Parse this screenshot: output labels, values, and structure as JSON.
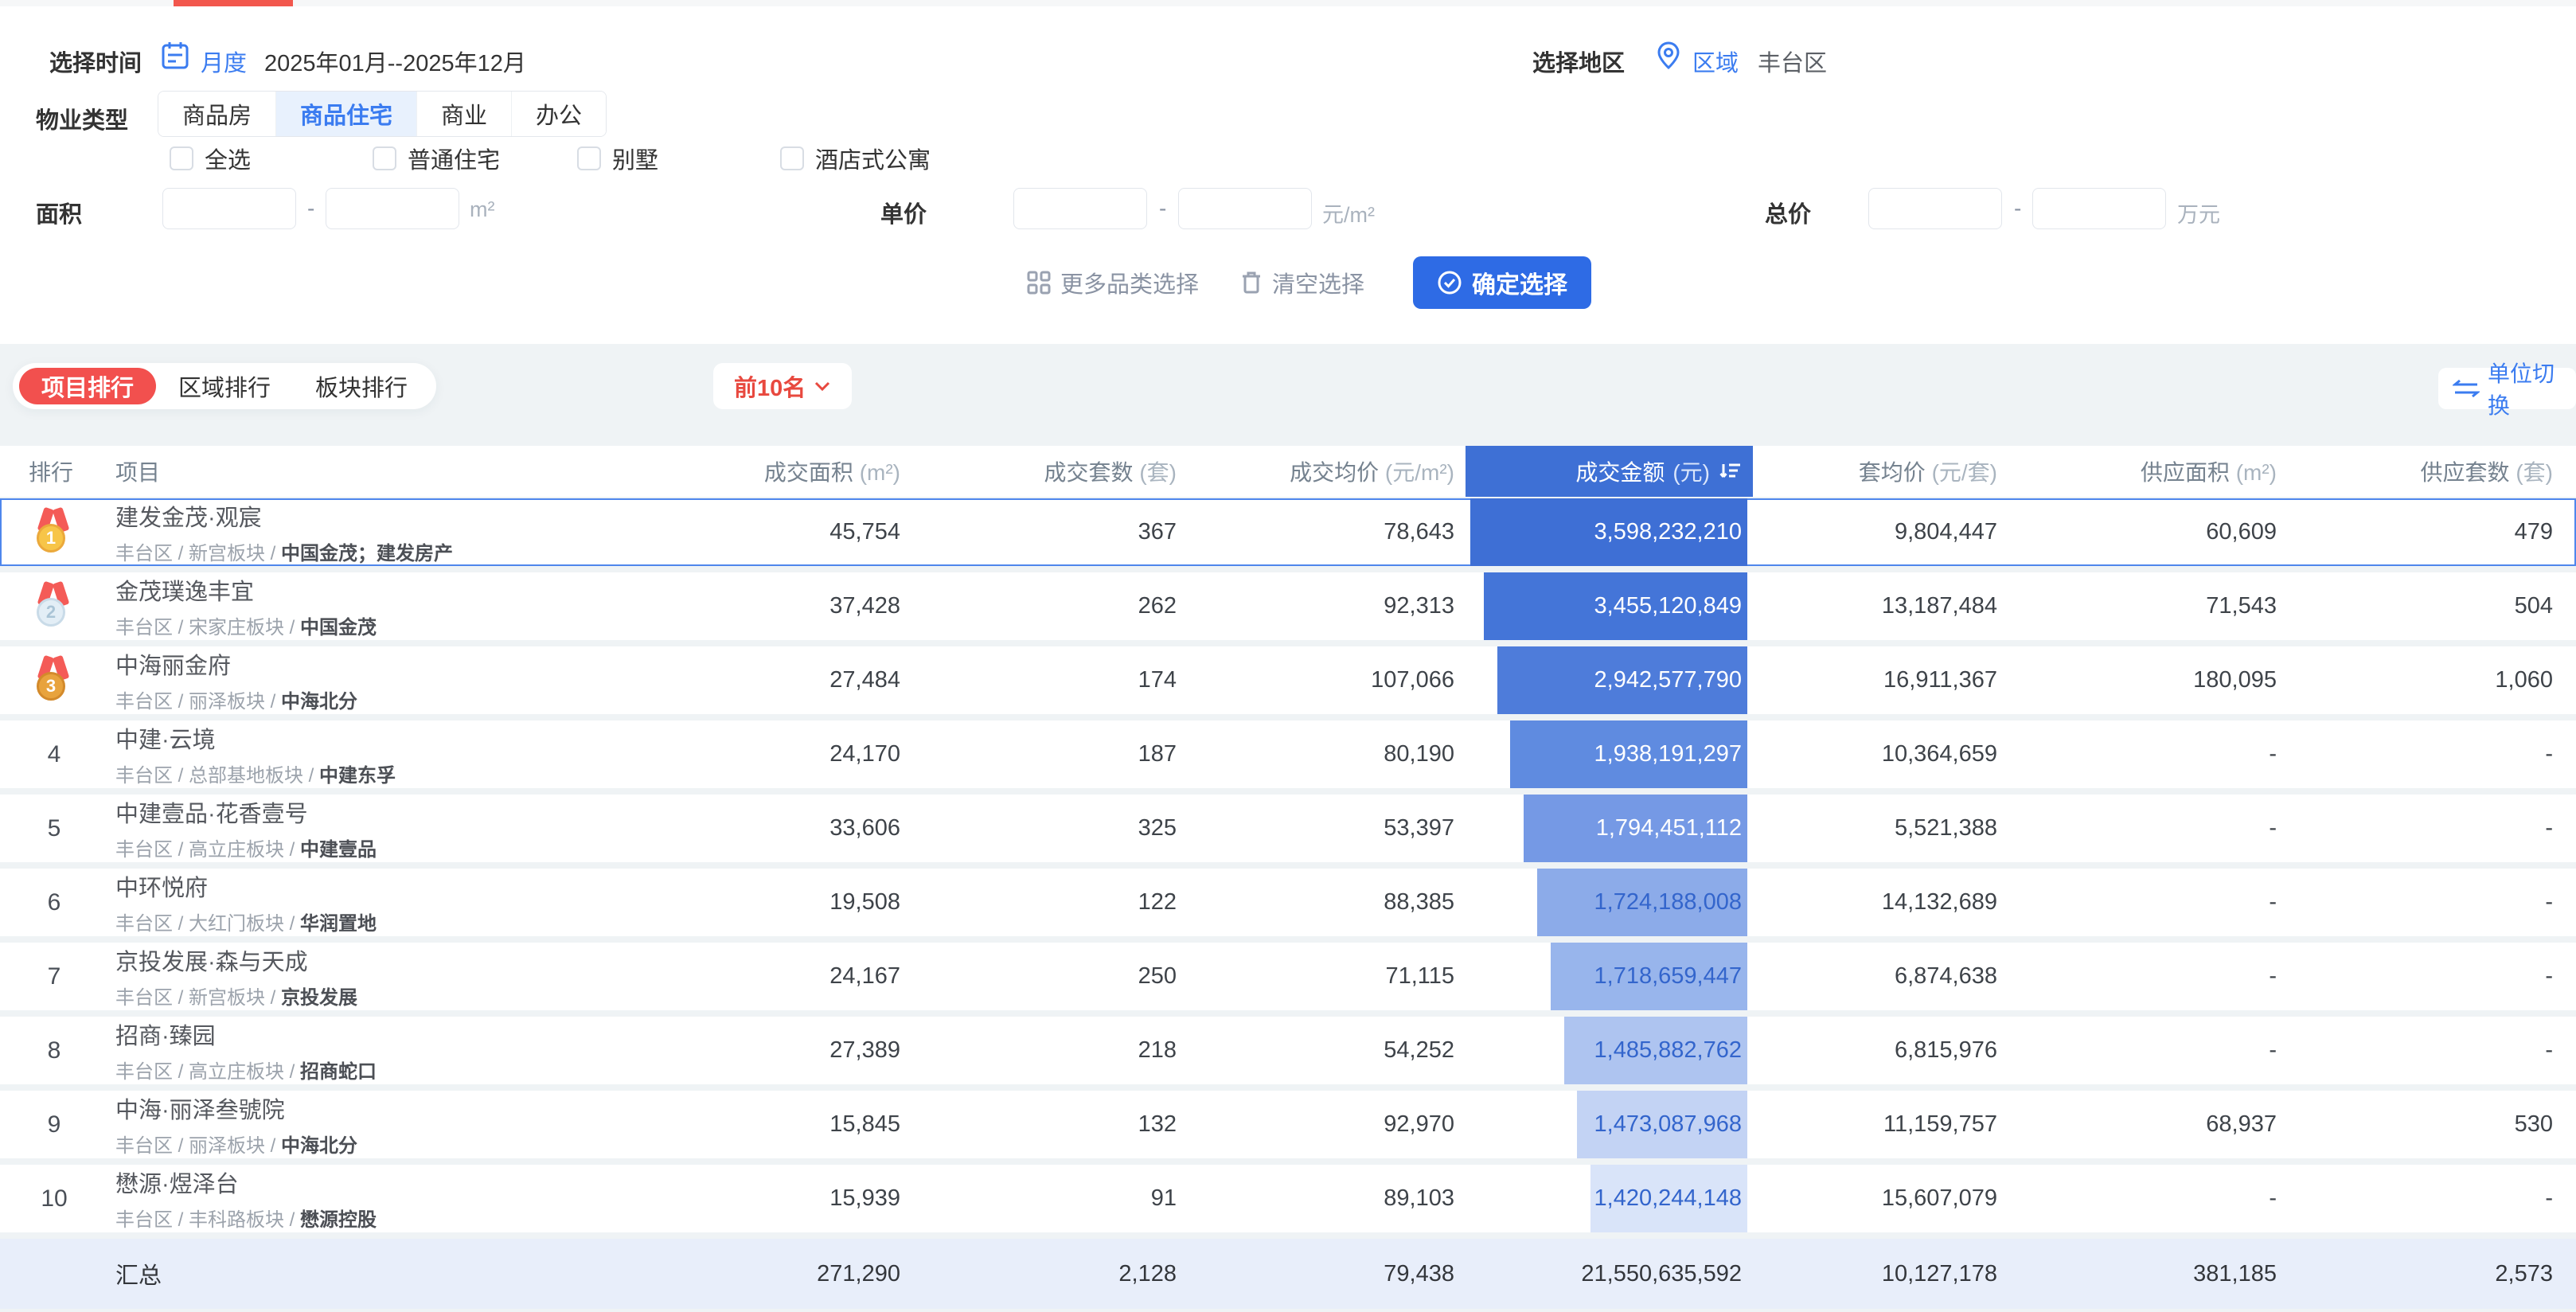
{
  "filters": {
    "time": {
      "label": "选择时间",
      "mode": "月度",
      "range": "2025年01月--2025年12月"
    },
    "region": {
      "label": "选择地区",
      "prefix": "区域",
      "value": "丰台区"
    },
    "property": {
      "label": "物业类型",
      "tabs": [
        "商品房",
        "商品住宅",
        "商业",
        "办公"
      ],
      "active_tab": "商品住宅",
      "checkboxes": [
        "全选",
        "普通住宅",
        "别墅",
        "酒店式公寓"
      ]
    },
    "area": {
      "label": "面积",
      "unit": "m²",
      "min": "",
      "max": ""
    },
    "unit_price": {
      "label": "单价",
      "unit": "元/m²",
      "min": "",
      "max": ""
    },
    "total_price": {
      "label": "总价",
      "unit": "万元",
      "min": "",
      "max": ""
    },
    "actions": {
      "more": "更多品类选择",
      "clear": "清空选择",
      "confirm": "确定选择"
    }
  },
  "ranking": {
    "tabs": [
      "项目排行",
      "区域排行",
      "板块排行"
    ],
    "active_tab": "项目排行",
    "top_label": "前10名",
    "unit_switch": "单位切换",
    "columns": [
      {
        "label": "排行",
        "unit": ""
      },
      {
        "label": "项目",
        "unit": ""
      },
      {
        "label": "成交面积",
        "unit": "(m²)"
      },
      {
        "label": "成交套数",
        "unit": "(套)"
      },
      {
        "label": "成交均价",
        "unit": "(元/m²)"
      },
      {
        "label": "成交金额",
        "unit": "(元)"
      },
      {
        "label": "套均价",
        "unit": "(元/套)"
      },
      {
        "label": "供应面积",
        "unit": "(m²)"
      },
      {
        "label": "供应套数",
        "unit": "(套)"
      }
    ],
    "rows": [
      {
        "rank": "1",
        "medal": "gold",
        "name": "建发金茂·观宸",
        "location": "丰台区 / 新宫板块 / ",
        "developer": "中国金茂；建发房产",
        "deal_area": "45,754",
        "deal_units": "367",
        "deal_avg_price": "78,643",
        "deal_amount": "3,598,232,210",
        "unit_avg_price": "9,804,447",
        "supply_area": "60,609",
        "supply_units": "479"
      },
      {
        "rank": "2",
        "medal": "silver",
        "name": "金茂璞逸丰宜",
        "location": "丰台区 / 宋家庄板块 / ",
        "developer": "中国金茂",
        "deal_area": "37,428",
        "deal_units": "262",
        "deal_avg_price": "92,313",
        "deal_amount": "3,455,120,849",
        "unit_avg_price": "13,187,484",
        "supply_area": "71,543",
        "supply_units": "504"
      },
      {
        "rank": "3",
        "medal": "bronze",
        "name": "中海丽金府",
        "location": "丰台区 / 丽泽板块 / ",
        "developer": "中海北分",
        "deal_area": "27,484",
        "deal_units": "174",
        "deal_avg_price": "107,066",
        "deal_amount": "2,942,577,790",
        "unit_avg_price": "16,911,367",
        "supply_area": "180,095",
        "supply_units": "1,060"
      },
      {
        "rank": "4",
        "medal": "",
        "name": "中建·云境",
        "location": "丰台区 / 总部基地板块 / ",
        "developer": "中建东孚",
        "deal_area": "24,170",
        "deal_units": "187",
        "deal_avg_price": "80,190",
        "deal_amount": "1,938,191,297",
        "unit_avg_price": "10,364,659",
        "supply_area": "-",
        "supply_units": "-"
      },
      {
        "rank": "5",
        "medal": "",
        "name": "中建壹品·花香壹号",
        "location": "丰台区 / 高立庄板块 / ",
        "developer": "中建壹品",
        "deal_area": "33,606",
        "deal_units": "325",
        "deal_avg_price": "53,397",
        "deal_amount": "1,794,451,112",
        "unit_avg_price": "5,521,388",
        "supply_area": "-",
        "supply_units": "-"
      },
      {
        "rank": "6",
        "medal": "",
        "name": "中环悦府",
        "location": "丰台区 / 大红门板块 / ",
        "developer": "华润置地",
        "deal_area": "19,508",
        "deal_units": "122",
        "deal_avg_price": "88,385",
        "deal_amount": "1,724,188,008",
        "unit_avg_price": "14,132,689",
        "supply_area": "-",
        "supply_units": "-"
      },
      {
        "rank": "7",
        "medal": "",
        "name": "京投发展·森与天成",
        "location": "丰台区 / 新宫板块 / ",
        "developer": "京投发展",
        "deal_area": "24,167",
        "deal_units": "250",
        "deal_avg_price": "71,115",
        "deal_amount": "1,718,659,447",
        "unit_avg_price": "6,874,638",
        "supply_area": "-",
        "supply_units": "-"
      },
      {
        "rank": "8",
        "medal": "",
        "name": "招商·臻园",
        "location": "丰台区 / 高立庄板块 / ",
        "developer": "招商蛇口",
        "deal_area": "27,389",
        "deal_units": "218",
        "deal_avg_price": "54,252",
        "deal_amount": "1,485,882,762",
        "unit_avg_price": "6,815,976",
        "supply_area": "-",
        "supply_units": "-"
      },
      {
        "rank": "9",
        "medal": "",
        "name": "中海·丽泽叁號院",
        "location": "丰台区 / 丽泽板块 / ",
        "developer": "中海北分",
        "deal_area": "15,845",
        "deal_units": "132",
        "deal_avg_price": "92,970",
        "deal_amount": "1,473,087,968",
        "unit_avg_price": "11,159,757",
        "supply_area": "68,937",
        "supply_units": "530"
      },
      {
        "rank": "10",
        "medal": "",
        "name": "懋源·煜泽台",
        "location": "丰台区 / 丰科路板块 / ",
        "developer": "懋源控股",
        "deal_area": "15,939",
        "deal_units": "91",
        "deal_avg_price": "89,103",
        "deal_amount": "1,420,244,148",
        "unit_avg_price": "15,607,079",
        "supply_area": "-",
        "supply_units": "-"
      }
    ],
    "summary": {
      "label": "汇总",
      "deal_area": "271,290",
      "deal_units": "2,128",
      "deal_avg_price": "79,438",
      "deal_amount": "21,550,635,592",
      "unit_avg_price": "10,127,178",
      "supply_area": "381,185",
      "supply_units": "2,573"
    }
  },
  "colors": {
    "accent_blue": "#2e6be5",
    "link_blue": "#3b7cf0",
    "active_tab_red": "#f2504e",
    "top10_red": "#e8493f",
    "top_indicator_red": "#f2574d",
    "amount_header_bg": "#3e70d5",
    "bar_palette": [
      "#3e6fd5",
      "#4475d8",
      "#4e7cda",
      "#5f8be0",
      "#7599e5",
      "#8cabe9",
      "#98b5ec",
      "#aec4f0",
      "#c3d3f4",
      "#d9e4f9"
    ],
    "bar_text_light": "#ffffff",
    "bar_text_dark": "#3365cc",
    "summary_bg": "#e8eefa",
    "medal_ribbon": "#f45b57",
    "medal_gold": "#f7c548",
    "medal_silver": "#e3eef6",
    "medal_bronze": "#e8a33d"
  }
}
